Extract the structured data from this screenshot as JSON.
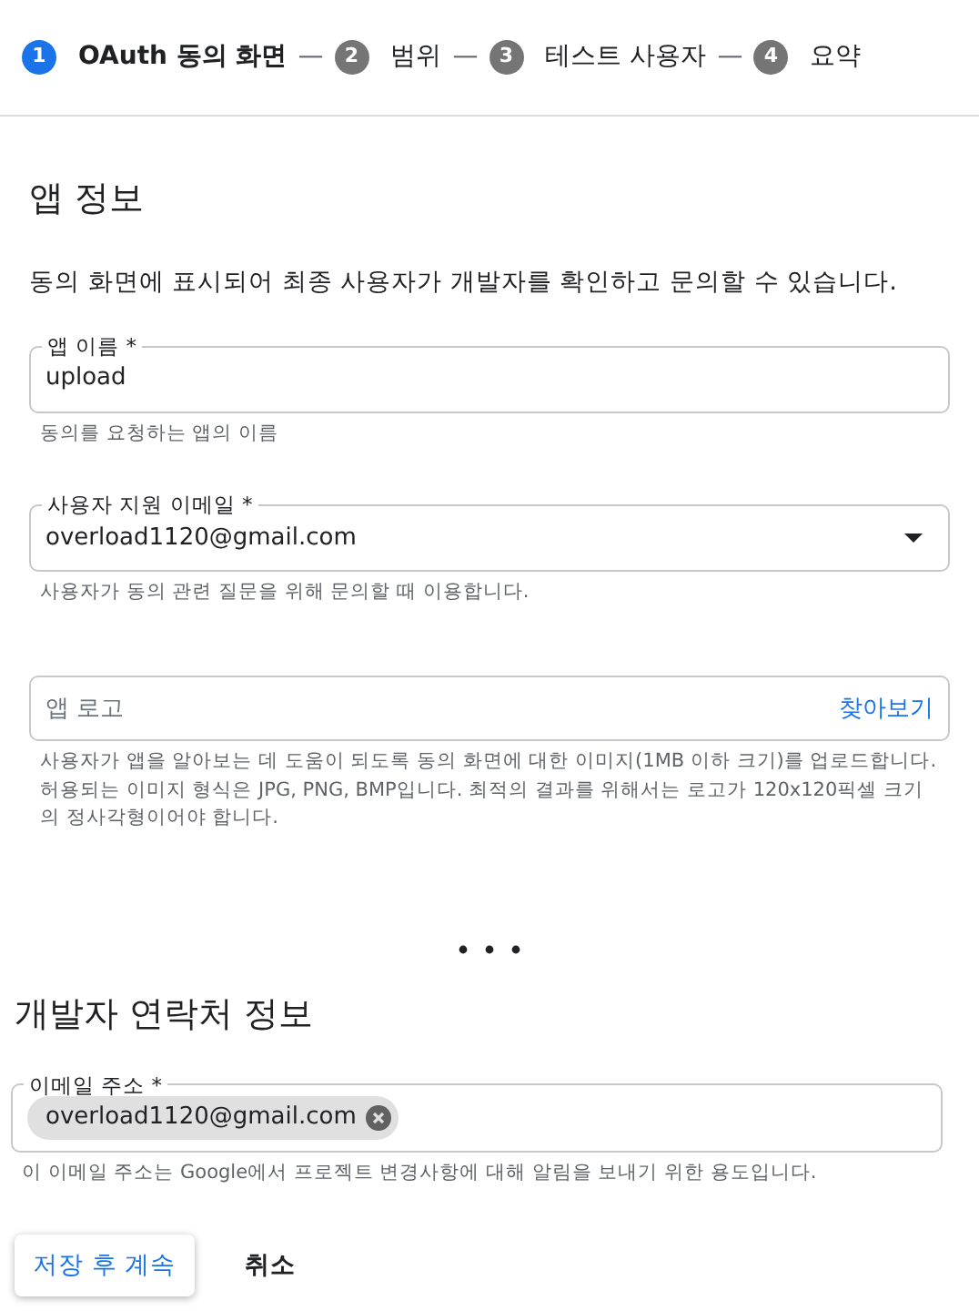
{
  "stepper": [
    {
      "number": "1",
      "label": "OAuth 동의 화면",
      "selected": true,
      "separator": "—"
    },
    {
      "number": "2",
      "label": "범위",
      "selected": false,
      "separator": "—"
    },
    {
      "number": "3",
      "label": "테스트 사용자",
      "selected": false,
      "separator": "—"
    },
    {
      "number": "4",
      "label": "요약",
      "selected": false
    }
  ],
  "app_info": {
    "title": "앱 정보",
    "description": "동의 화면에 표시되어 최종 사용자가 개발자를 확인하고 문의할 수 있습니다.",
    "fields": [
      {
        "kind": "text",
        "label": "앱 이름 *",
        "value": "upload",
        "helper": "동의를 요청하는 앱의 이름"
      },
      {
        "kind": "select",
        "label": "사용자 지원 이메일 *",
        "value": "overload1120@gmail.com",
        "helper": "사용자가 동의 관련 질문을 위해 문의할 때 이용합니다."
      },
      {
        "kind": "file",
        "placeholder": "앱 로고",
        "action": "찾아보기",
        "helper": "사용자가 앱을 알아보는 데 도움이 되도록 동의 화면에 대한 이미지(1MB 이하 크기)를 업로드합니다. 허용되는 이미지 형식은 JPG, PNG, BMP입니다. 최적의 결과를 위해서는 로고가 120x120픽셀 크기의 정사각형이어야 합니다."
      }
    ]
  },
  "developer_contact": {
    "title": "개발자 연락처 정보",
    "fields": [
      {
        "kind": "chips",
        "label": "이메일 주소 *",
        "chips": [
          "overload1120@gmail.com"
        ],
        "helper": "이 이메일 주소는 Google에서 프로젝트 변경사항에 대해 알림을 보내기 위한 용도입니다."
      }
    ]
  },
  "buttons": [
    {
      "kind": "raised",
      "label": "저장 후 계속"
    },
    {
      "kind": "flat",
      "label": "취소"
    }
  ]
}
